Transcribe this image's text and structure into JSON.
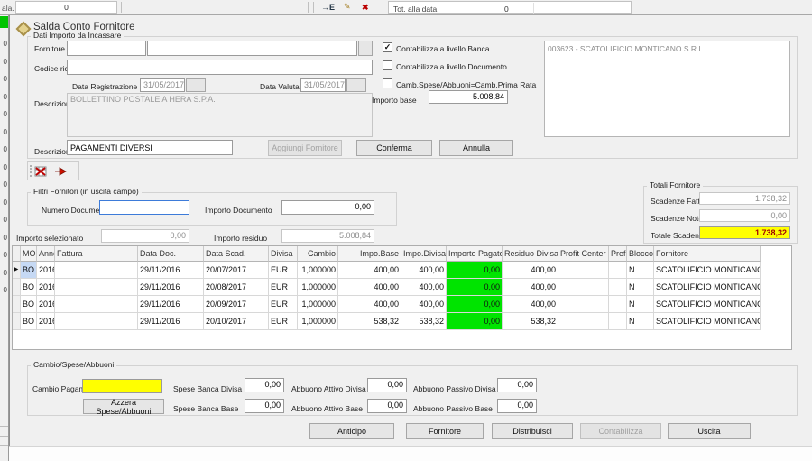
{
  "colors": {
    "paid_green": "#00e400",
    "selected_cell": "#c6d9f4",
    "accent_yellow": "#ffff00",
    "totale_text": "#a00000"
  },
  "background_bar": {
    "left_label": "ala.",
    "left_value": "0",
    "export_icon": "→E",
    "pencil_icon": "✎",
    "delete_icon": "✖",
    "tot_label": "Tot. alla data.",
    "tot_value": "0",
    "side_cells": [
      "0",
      "0",
      "0",
      "0",
      "0",
      "0",
      "0",
      "0",
      "0",
      "0",
      "0",
      "0",
      "0",
      "0",
      "0"
    ]
  },
  "window": {
    "title": "Salda Conto Fornitore"
  },
  "dati": {
    "group_label": "Dati Importo da Incassare",
    "fornitore_label": "Fornitore",
    "fornitore_code": "",
    "fornitore_name": "",
    "browse_label": "...",
    "codice_ricerca_label": "Codice ricerca",
    "codice_ricerca_value": "",
    "data_registrazione_label": "Data Registrazione",
    "data_registrazione_value": "31/05/2017",
    "data_valuta_label": "Data Valuta",
    "data_valuta_value": "31/05/2017",
    "descrizione_hb_label": "Descrizione HB",
    "descrizione_hb_value": "BOLLETTINO POSTALE A HERA S.P.A.",
    "checkbox_banca_label": "Contabilizza a livello Banca",
    "checkbox_banca_checked": true,
    "checkbox_documento_label": "Contabilizza a livello Documento",
    "checkbox_documento_checked": false,
    "checkbox_camb_label": "Camb.Spese/Abbuoni=Camb.Prima Rata",
    "checkbox_camb_checked": false,
    "importo_base_label": "Importo base",
    "importo_base_value": "5.008,84",
    "supplier_list_item": "003623 - SCATOLIFICIO MONTICANO S.R.L.",
    "descrizione_label": "Descrizione",
    "descrizione_value": "PAGAMENTI DIVERSI",
    "aggiungi_button": "Aggiungi Fornitore",
    "conferma_button": "Conferma",
    "annulla_button": "Annulla"
  },
  "filtri": {
    "group_label": "Filtri Fornitori (in uscita campo)",
    "numero_documento_label": "Numero Documento",
    "numero_documento_value": "",
    "importo_documento_label": "Importo Documento",
    "importo_documento_value": "0,00"
  },
  "importi": {
    "selezionato_label": "Importo selezionato",
    "selezionato_value": "0,00",
    "residuo_label": "Importo residuo",
    "residuo_value": "5.008,84"
  },
  "totali": {
    "group_label": "Totali Fornitore",
    "scadenze_fatture_label": "Scadenze Fatture",
    "scadenze_fatture_value": "1.738,32",
    "scadenze_note_label": "Scadenze Note Credito",
    "scadenze_note_value": "0,00",
    "totale_label": "Totale Scadenze",
    "totale_value": "1.738,32"
  },
  "table": {
    "headers": [
      "MO.",
      "Anno",
      "Fattura",
      "Data Doc.",
      "Data Scad.",
      "Divisa",
      "Cambio",
      "Impo.Base",
      "Impo.Divisa",
      "Importo Pagato",
      "Residuo Divisa",
      "Profit Center",
      "Prefi",
      "Blocco",
      "Fornitore"
    ],
    "rows": [
      [
        "BO",
        "2016",
        "",
        "29/11/2016",
        "20/07/2017",
        "EUR",
        "1,000000",
        "400,00",
        "400,00",
        "0,00",
        "400,00",
        "",
        "",
        "N",
        "SCATOLIFICIO MONTICANO"
      ],
      [
        "BO",
        "2016",
        "",
        "29/11/2016",
        "20/08/2017",
        "EUR",
        "1,000000",
        "400,00",
        "400,00",
        "0,00",
        "400,00",
        "",
        "",
        "N",
        "SCATOLIFICIO MONTICANO"
      ],
      [
        "BO",
        "2016",
        "",
        "29/11/2016",
        "20/09/2017",
        "EUR",
        "1,000000",
        "400,00",
        "400,00",
        "0,00",
        "400,00",
        "",
        "",
        "N",
        "SCATOLIFICIO MONTICANO"
      ],
      [
        "BO",
        "2016",
        "",
        "29/11/2016",
        "20/10/2017",
        "EUR",
        "1,000000",
        "538,32",
        "538,32",
        "0,00",
        "538,32",
        "",
        "",
        "N",
        "SCATOLIFICIO MONTICANO"
      ]
    ]
  },
  "cambio": {
    "group_label": "Cambio/Spese/Abbuoni",
    "cambio_pagamento_label": "Cambio Pagamento",
    "cambio_pagamento_value": "",
    "azzera_button": "Azzera Spese/Abbuoni",
    "spese_divisa_label": "Spese Banca Divisa",
    "spese_divisa_value": "0,00",
    "spese_base_label": "Spese Banca Base",
    "spese_base_value": "0,00",
    "abbuono_attivo_divisa_label": "Abbuono Attivo Divisa",
    "abbuono_attivo_divisa_value": "0,00",
    "abbuono_attivo_base_label": "Abbuono Attivo Base",
    "abbuono_attivo_base_value": "0,00",
    "abbuono_passivo_divisa_label": "Abbuono Passivo Divisa",
    "abbuono_passivo_divisa_value": "0,00",
    "abbuono_passivo_base_label": "Abbuono Passivo Base",
    "abbuono_passivo_base_value": "0,00"
  },
  "actions": {
    "anticipo": "Anticipo",
    "fornitore": "Fornitore",
    "distribuisci": "Distribuisci",
    "contabilizza": "Contabilizza",
    "uscita": "Uscita"
  }
}
